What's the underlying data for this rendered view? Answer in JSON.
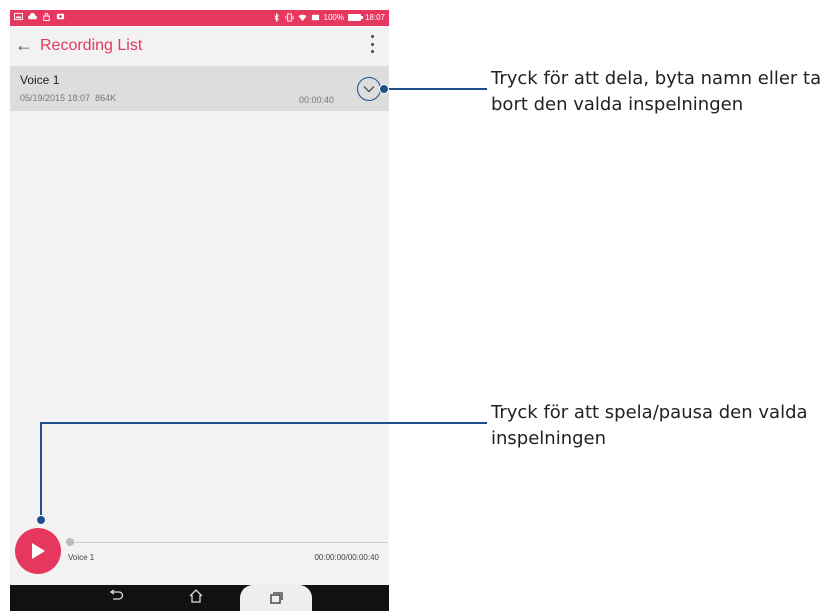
{
  "status_bar": {
    "left_icons": [
      "gallery-icon",
      "cloud-icon",
      "lock-icon",
      "notification-icon"
    ],
    "right_icons": [
      "bluetooth-icon",
      "vibrate-icon",
      "wifi-icon",
      "battery-saver-icon"
    ],
    "battery": "100%",
    "time": "18:07",
    "color": "#e6385f"
  },
  "app_bar": {
    "title": "Recording List",
    "title_color": "#e6385f"
  },
  "recordings": [
    {
      "name": "Voice 1",
      "date": "05/19/2015 18:07",
      "size": "864K",
      "duration": "00:00:40"
    }
  ],
  "player": {
    "track_name": "Voice 1",
    "time": "00:00:00/00:00:40",
    "progress": 0
  },
  "nav_bar": {
    "buttons": [
      "back-icon",
      "home-icon",
      "recents-icon"
    ]
  },
  "callouts": {
    "options": "Tryck för att dela, byta namn eller ta bort den valda inspelningen",
    "play": "Tryck för att spela/pausa den valda inspelningen",
    "line_color": "#1f4e8c"
  }
}
